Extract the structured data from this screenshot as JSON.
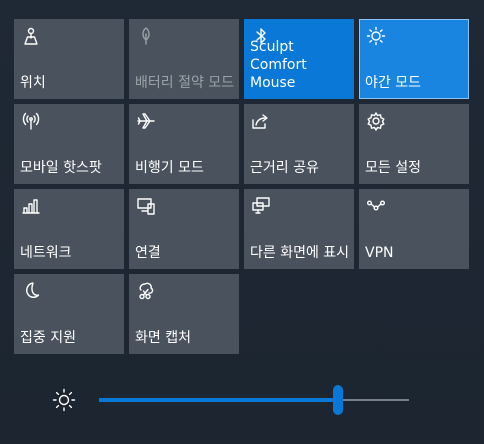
{
  "tiles": [
    {
      "label": "위치",
      "icon": "location-icon",
      "state": "off"
    },
    {
      "label": "배터리 절약 모드",
      "icon": "battery-saver-icon",
      "state": "disabled"
    },
    {
      "label": "Sculpt Comfort Mouse",
      "icon": "bluetooth-icon",
      "state": "on"
    },
    {
      "label": "야간 모드",
      "icon": "night-light-icon",
      "state": "on"
    },
    {
      "label": "모바일 핫스팟",
      "icon": "mobile-hotspot-icon",
      "state": "off"
    },
    {
      "label": "비행기 모드",
      "icon": "airplane-icon",
      "state": "off"
    },
    {
      "label": "근거리 공유",
      "icon": "nearby-share-icon",
      "state": "off"
    },
    {
      "label": "모든 설정",
      "icon": "gear-icon",
      "state": "off"
    },
    {
      "label": "네트워크",
      "icon": "network-icon",
      "state": "off"
    },
    {
      "label": "연결",
      "icon": "connect-icon",
      "state": "off"
    },
    {
      "label": "다른 화면에 표시",
      "icon": "project-icon",
      "state": "off"
    },
    {
      "label": "VPN",
      "icon": "vpn-icon",
      "state": "off"
    },
    {
      "label": "집중 지원",
      "icon": "focus-assist-icon",
      "state": "off"
    },
    {
      "label": "화면 캡처",
      "icon": "screen-snip-icon",
      "state": "off"
    }
  ],
  "brightness": {
    "icon": "brightness-icon",
    "value_fraction": 0.77
  },
  "colors": {
    "tile_bg": "#4a535d",
    "accent": "#0a78d7",
    "background": "#1f2935"
  }
}
